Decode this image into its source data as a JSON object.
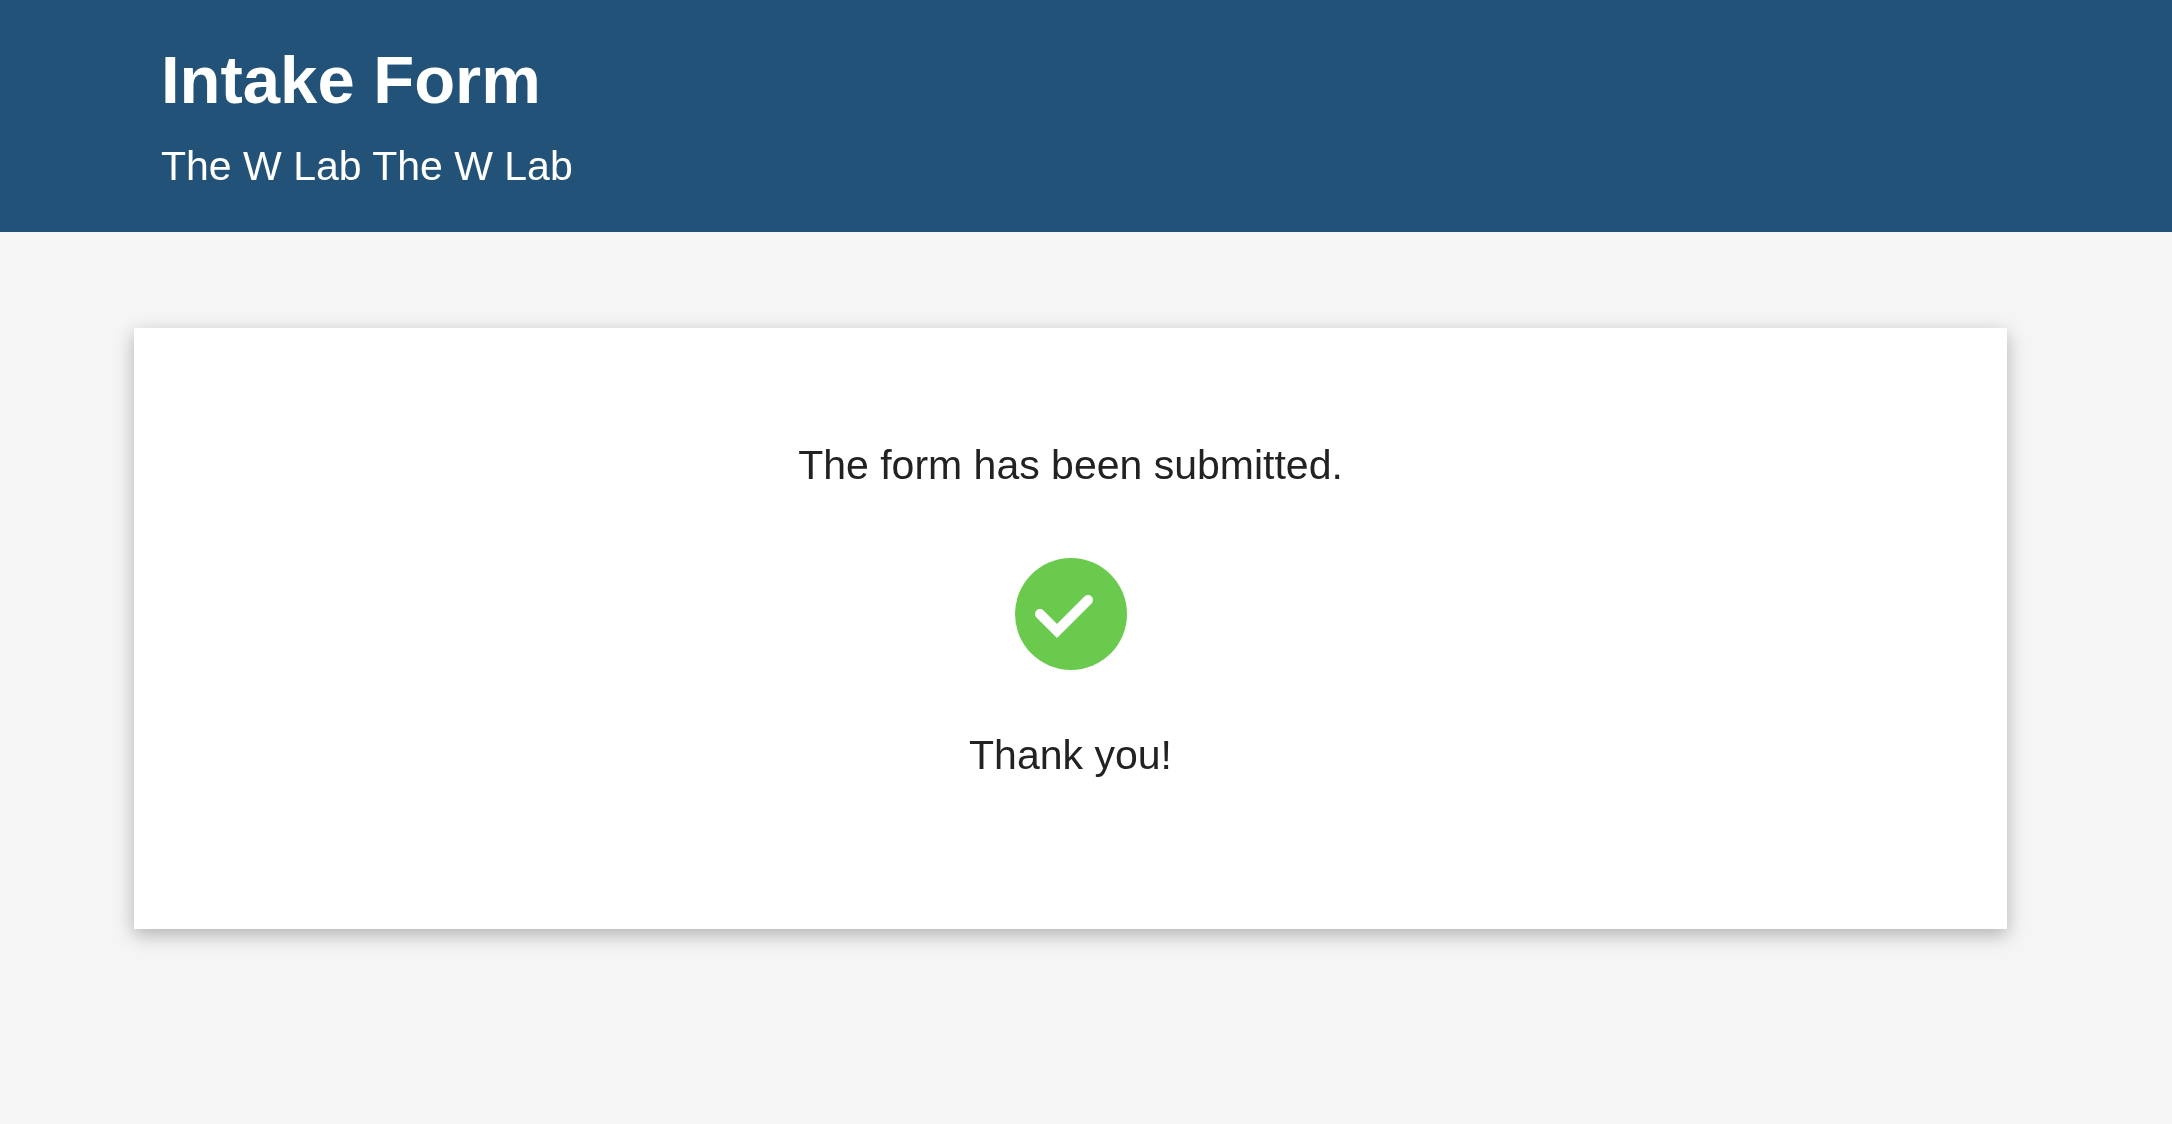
{
  "header": {
    "title": "Intake Form",
    "subtitle": "The W Lab The W Lab"
  },
  "confirmation": {
    "message": "The form has been submitted.",
    "thanks": "Thank you!"
  }
}
